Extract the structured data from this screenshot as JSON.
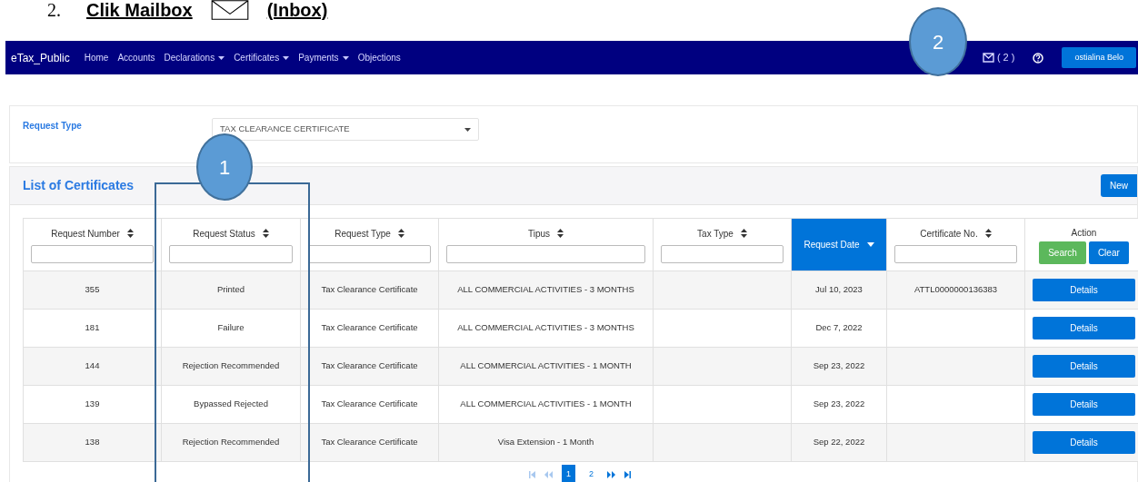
{
  "heading": {
    "number": "2.",
    "text": "Clik Mailbox",
    "suffix": "(Inbox)"
  },
  "navbar": {
    "brand": "eTax_Public",
    "items": [
      {
        "label": "Home",
        "dropdown": false
      },
      {
        "label": "Accounts",
        "dropdown": false
      },
      {
        "label": "Declarations",
        "dropdown": true
      },
      {
        "label": "Certificates",
        "dropdown": true
      },
      {
        "label": "Payments",
        "dropdown": true
      },
      {
        "label": "Objections",
        "dropdown": false
      }
    ],
    "inbox_count": "( 2 )",
    "user": "ostialina Belo"
  },
  "filter": {
    "label": "Request Type",
    "value": "TAX CLEARANCE CERTIFICATE"
  },
  "list": {
    "title": "List of Certificates",
    "new_button": "New"
  },
  "table": {
    "columns": [
      {
        "label": "Request Number",
        "sortable": true,
        "selected": false,
        "kind": "filter"
      },
      {
        "label": "Request Status",
        "sortable": true,
        "selected": false,
        "kind": "filter"
      },
      {
        "label": "Request Type",
        "sortable": true,
        "selected": false,
        "kind": "filter"
      },
      {
        "label": "Tipus",
        "sortable": true,
        "selected": false,
        "kind": "filter"
      },
      {
        "label": "Tax Type",
        "sortable": true,
        "selected": false,
        "kind": "filter"
      },
      {
        "label": "Request Date",
        "sortable": true,
        "selected": true,
        "kind": "plain"
      },
      {
        "label": "Certificate No.",
        "sortable": true,
        "selected": false,
        "kind": "filter"
      },
      {
        "label": "Action",
        "sortable": false,
        "selected": false,
        "kind": "action",
        "buttons": [
          {
            "label": "Search",
            "color": "#5cb85c"
          },
          {
            "label": "Clear",
            "color": "#0275d8"
          }
        ]
      }
    ],
    "rows": [
      {
        "cells": [
          "355",
          "Printed",
          "Tax Clearance Certificate",
          "ALL COMMERCIAL ACTIVITIES - 3 MONTHS",
          "",
          "Jul 10, 2023",
          "ATTL0000000136383"
        ],
        "action": "Details"
      },
      {
        "cells": [
          "181",
          "Failure",
          "Tax Clearance Certificate",
          "ALL COMMERCIAL ACTIVITIES - 3 MONTHS",
          "",
          "Dec 7, 2022",
          ""
        ],
        "action": "Details"
      },
      {
        "cells": [
          "144",
          "Rejection Recommended",
          "Tax Clearance Certificate",
          "ALL COMMERCIAL ACTIVITIES - 1 MONTH",
          "",
          "Sep 23, 2022",
          ""
        ],
        "action": "Details"
      },
      {
        "cells": [
          "139",
          "Bypassed Rejected",
          "Tax Clearance Certificate",
          "ALL COMMERCIAL ACTIVITIES - 1 MONTH",
          "",
          "Sep 23, 2022",
          ""
        ],
        "action": "Details"
      },
      {
        "cells": [
          "138",
          "Rejection Recommended",
          "Tax Clearance Certificate",
          "Visa Extension - 1 Month",
          "",
          "Sep 22, 2022",
          ""
        ],
        "action": "Details"
      }
    ]
  },
  "pagination": {
    "pages": [
      {
        "label": "1",
        "selected": true
      },
      {
        "label": "2",
        "selected": false
      }
    ]
  },
  "annotations": [
    {
      "label": "1",
      "kind": "column"
    },
    {
      "label": "2",
      "kind": "circle"
    }
  ]
}
